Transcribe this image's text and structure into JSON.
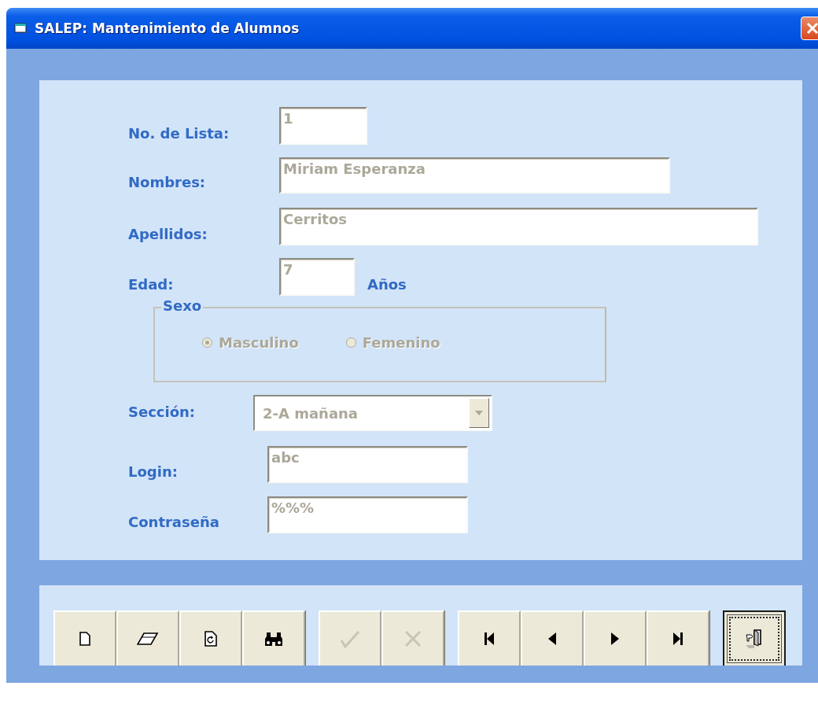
{
  "window": {
    "title": "SALEP: Mantenimiento de Alumnos"
  },
  "form": {
    "rows": [
      {
        "kind": "text",
        "label": "No. de Lista:",
        "value": "1",
        "disabled": true
      },
      {
        "kind": "text",
        "label": "Nombres:",
        "value": "Miriam Esperanza",
        "disabled": true
      },
      {
        "kind": "text",
        "label": "Apellidos:",
        "value": "Cerritos",
        "disabled": true
      },
      {
        "kind": "text",
        "label": "Edad:",
        "value": "7",
        "suffix": "Años",
        "disabled": true
      },
      {
        "kind": "radio_group",
        "title": "Sexo",
        "options": [
          {
            "label": "Masculino",
            "selected": true,
            "disabled": true
          },
          {
            "label": "Femenino",
            "selected": false,
            "disabled": true
          }
        ]
      },
      {
        "kind": "select",
        "label": "Sección:",
        "value": "2-A mañana",
        "disabled": true
      },
      {
        "kind": "text",
        "label": "Login:",
        "value": "abc",
        "disabled": true
      },
      {
        "kind": "text",
        "label": "Contraseña",
        "value": "%%%",
        "disabled": true
      }
    ]
  },
  "toolbar": {
    "groups": [
      [
        {
          "kind": "new",
          "disabled": false,
          "focused": false
        },
        {
          "kind": "erase",
          "disabled": false,
          "focused": false
        },
        {
          "kind": "edit",
          "disabled": false,
          "focused": false
        },
        {
          "kind": "search",
          "disabled": false,
          "focused": false
        }
      ],
      [
        {
          "kind": "accept",
          "disabled": true,
          "focused": false
        },
        {
          "kind": "cancel",
          "disabled": true,
          "focused": false
        }
      ],
      [
        {
          "kind": "first",
          "disabled": false,
          "focused": false
        },
        {
          "kind": "previous",
          "disabled": false,
          "focused": false
        },
        {
          "kind": "next",
          "disabled": false,
          "focused": false
        },
        {
          "kind": "last",
          "disabled": false,
          "focused": false
        }
      ],
      [
        {
          "kind": "exit",
          "disabled": false,
          "focused": true
        }
      ]
    ]
  }
}
